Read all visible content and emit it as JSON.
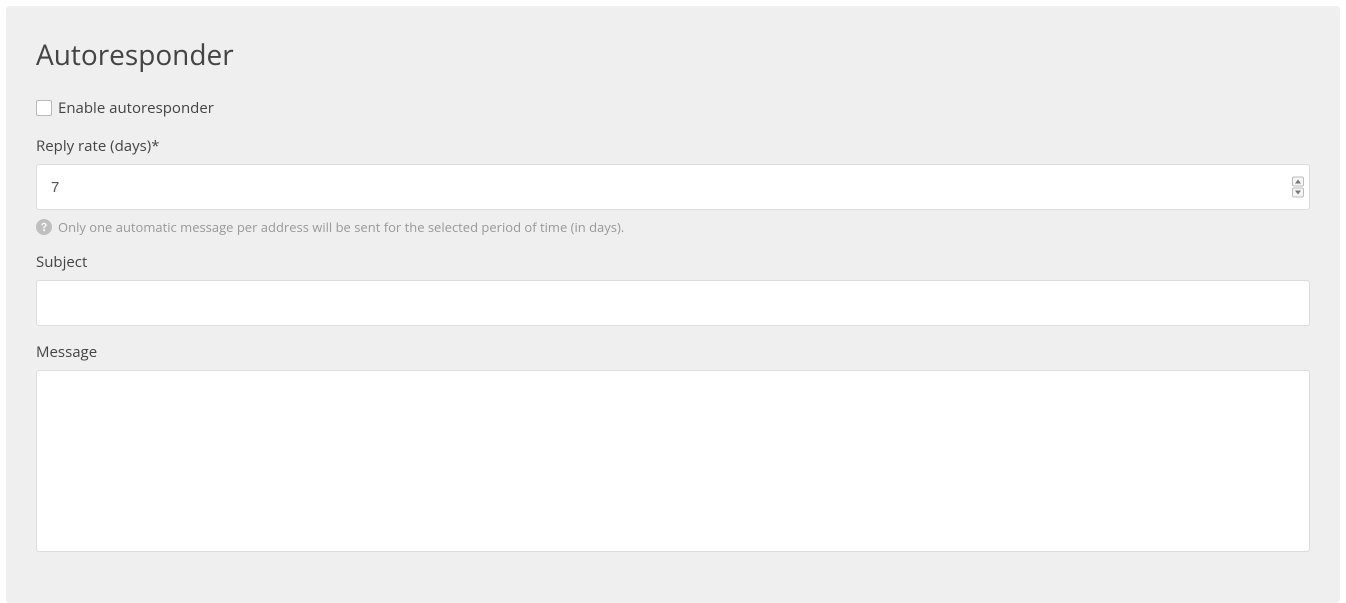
{
  "panel": {
    "title": "Autoresponder"
  },
  "form": {
    "enable": {
      "label": "Enable autoresponder",
      "checked": false
    },
    "replyRate": {
      "label": "Reply rate (days)*",
      "value": "7",
      "help": "Only one automatic message per address will be sent for the selected period of time (in days)."
    },
    "subject": {
      "label": "Subject",
      "value": ""
    },
    "message": {
      "label": "Message",
      "value": ""
    }
  }
}
